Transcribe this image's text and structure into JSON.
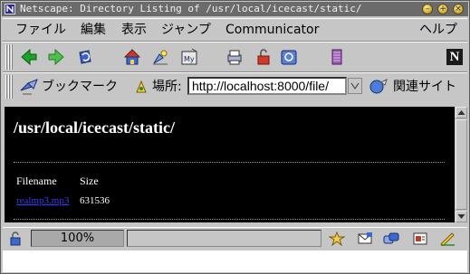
{
  "window": {
    "title": "Netscape: Directory Listing of /usr/local/icecast/static/",
    "controls": [
      "minimize-icon",
      "maximize-icon",
      "close-icon"
    ]
  },
  "menubar": {
    "items": [
      "ファイル",
      "編集",
      "表示",
      "ジャンプ",
      "Communicator",
      "ヘルプ"
    ]
  },
  "toolbar": {
    "buttons": [
      "back-icon",
      "forward-icon",
      "reload-icon",
      "home-icon",
      "search-icon",
      "mynetscape-icon",
      "print-icon",
      "security-icon",
      "shop-icon",
      "stop-icon"
    ],
    "brand": "N"
  },
  "location": {
    "bookmarks_label": "ブックマーク",
    "location_label": "場所:",
    "url": "http://localhost:8000/file/",
    "related_label": "関連サイト"
  },
  "content": {
    "heading": "/usr/local/icecast/static/",
    "columns": [
      "Filename",
      "Size"
    ],
    "rows": [
      {
        "filename": "realmp3.mp3",
        "size": "631536"
      }
    ]
  },
  "status": {
    "progress": "100%",
    "message": ""
  },
  "colors": {
    "page_background": "#000000",
    "link": "#3a3aff",
    "chrome": "#c6c6c6",
    "titlebar": "#6b6b6b"
  }
}
